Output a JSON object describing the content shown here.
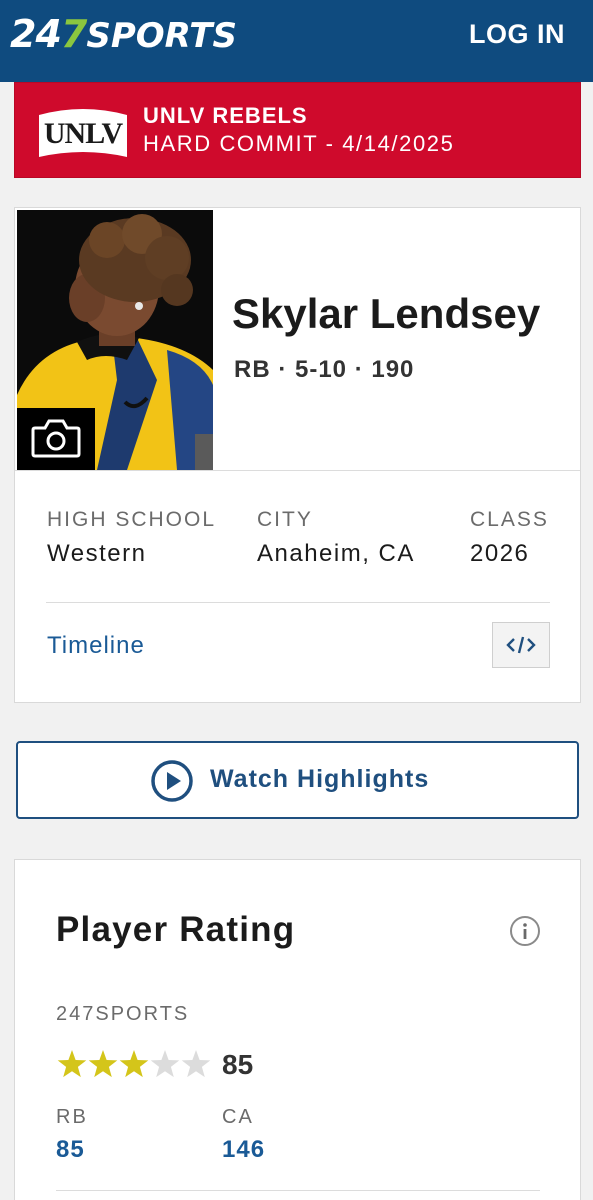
{
  "header": {
    "logo_247": "247",
    "logo_sports": "SPORTS",
    "login_label": "LOG IN"
  },
  "commit": {
    "team_logo_text": "UNLV",
    "team": "UNLV REBELS",
    "status": "HARD COMMIT - 4/14/2025",
    "banner_color": "#cf0a2c"
  },
  "player": {
    "name": "Skylar Lendsey",
    "meta": "RB · 5-10 · 190",
    "photo_icon": "camera-icon",
    "info": [
      {
        "label": "HIGH SCHOOL",
        "value": "Western"
      },
      {
        "label": "CITY",
        "value": "Anaheim, CA"
      },
      {
        "label": "CLASS",
        "value": "2026"
      }
    ],
    "timeline_label": "Timeline",
    "embed_icon": "code-embed-icon"
  },
  "highlights": {
    "label": "Watch Highlights",
    "icon": "play-circle-icon"
  },
  "rating": {
    "title": "Player Rating",
    "info_icon": "info-icon",
    "source": "247SPORTS",
    "stars_filled": 3,
    "stars_total": 5,
    "value": "85",
    "ranks": [
      {
        "label": "RB",
        "value": "85"
      },
      {
        "label": "CA",
        "value": "146"
      }
    ]
  },
  "colors": {
    "header_bg": "#0f4b7f",
    "accent_blue": "#1a5a96",
    "star_gold": "#d4c51a",
    "star_empty": "#dcdcdc",
    "logo_green": "#8bc63f"
  }
}
